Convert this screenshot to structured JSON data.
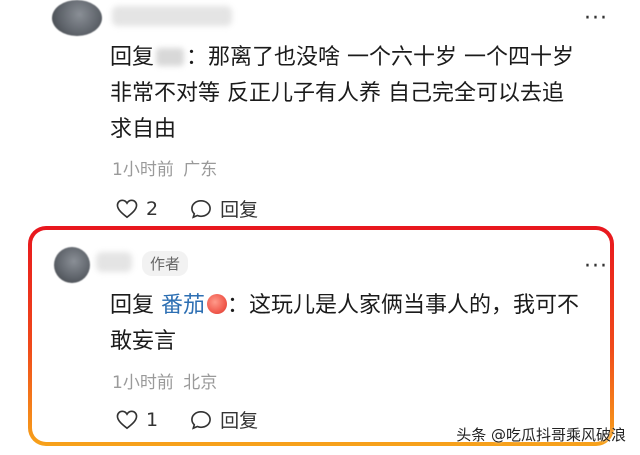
{
  "comments": [
    {
      "reply_prefix": "回复",
      "text": "：那离了也没啥 一个六十岁 一个四十岁非常不对等 反正儿子有人养 自己完全可以去追求自由",
      "line1": "：那离了也没啥 一个六十岁 一个四十岁",
      "line2": "非常不对等 反正儿子有人养 自己完全可以去追",
      "line3": "求自由",
      "time": "1小时前",
      "location": "广东",
      "likes": "2",
      "reply_label": "回复",
      "more_icon": "more-dots-icon"
    },
    {
      "author_tag": "作者",
      "reply_prefix": "回复",
      "reply_to": "番茄",
      "line1": "：这玩儿是人家俩当事人的，我可不",
      "line2": "敢妄言",
      "time": "1小时前",
      "location": "北京",
      "likes": "1",
      "reply_label": "回复",
      "more_icon": "more-dots-icon"
    }
  ],
  "highlight_color": "#e8161e",
  "watermark": "头条 @吃瓜抖哥乘风破浪"
}
